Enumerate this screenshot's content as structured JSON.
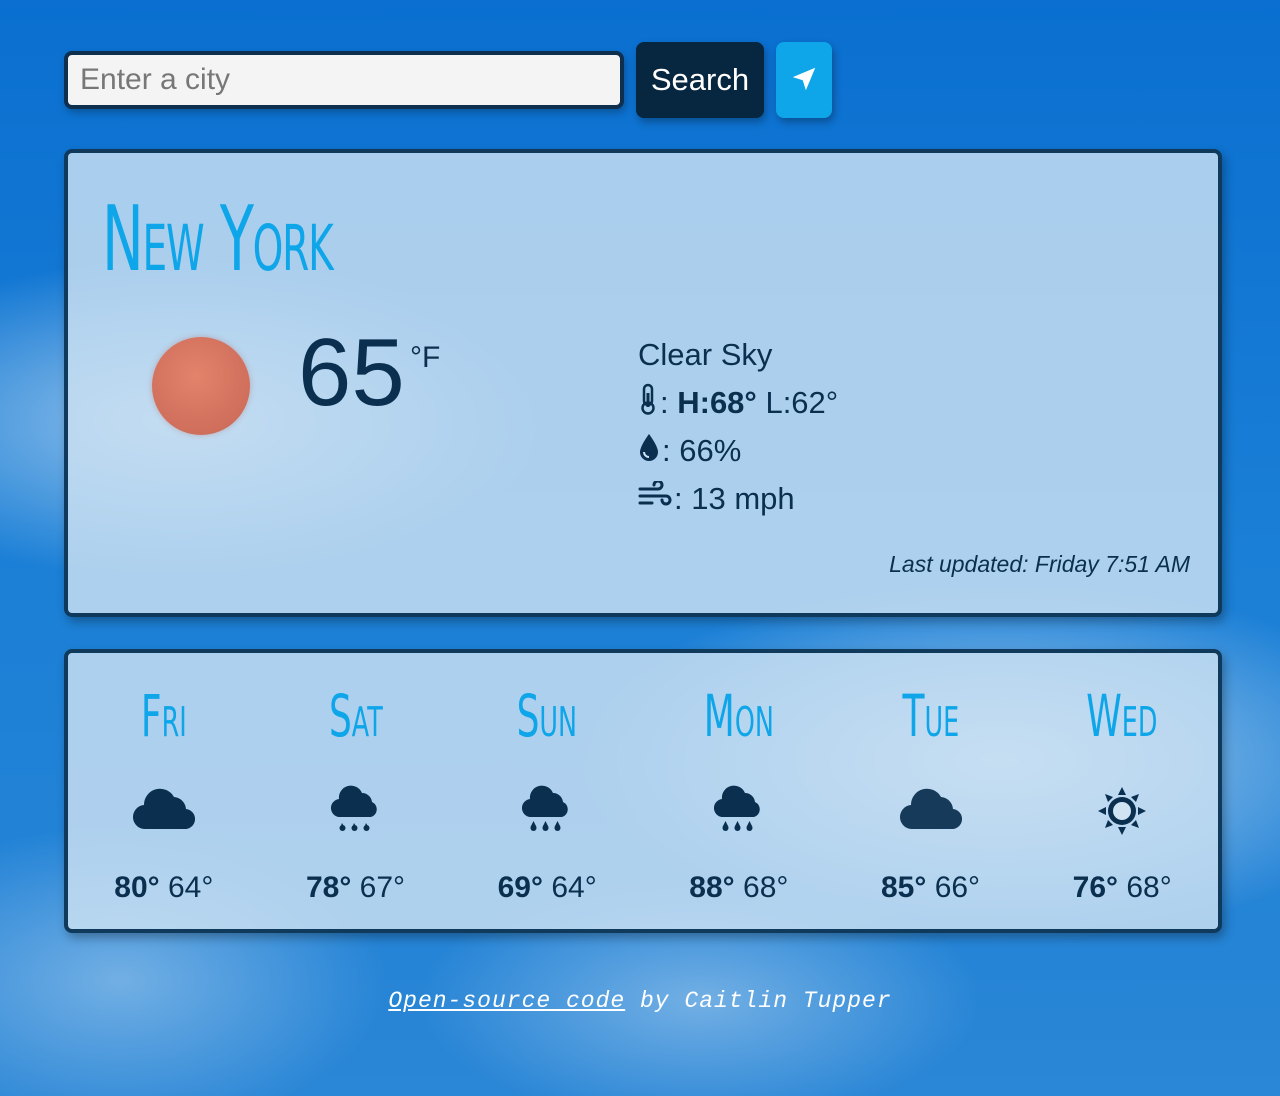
{
  "search": {
    "placeholder": "Enter a city",
    "button_label": "Search",
    "location_icon": "location-arrow-icon"
  },
  "current": {
    "city": "New York",
    "icon": "sun-icon",
    "temperature": "65",
    "unit": "°F",
    "description": "Clear Sky",
    "high_label": "H:68°",
    "low_label": "L:62°",
    "humidity": "66%",
    "wind": "13 mph",
    "last_updated": "Last updated: Friday 7:51 AM"
  },
  "forecast": [
    {
      "day": "Fri",
      "icon": "cloud-icon",
      "max": "80°",
      "min": "64°"
    },
    {
      "day": "Sat",
      "icon": "cloud-rain-icon",
      "max": "78°",
      "min": "67°"
    },
    {
      "day": "Sun",
      "icon": "cloud-rain-icon",
      "max": "69°",
      "min": "64°"
    },
    {
      "day": "Mon",
      "icon": "cloud-rain-icon",
      "max": "88°",
      "min": "68°"
    },
    {
      "day": "Tue",
      "icon": "cloud-icon",
      "max": "85°",
      "min": "66°"
    },
    {
      "day": "Wed",
      "icon": "sun-icon",
      "max": "76°",
      "min": "68°"
    }
  ],
  "footer": {
    "link_text": "Open-source code",
    "suffix": " by Caitlin Tupper"
  },
  "colors": {
    "accent": "#0ea5e9",
    "dark": "#0a2f4f",
    "button_dark": "#07263f"
  }
}
